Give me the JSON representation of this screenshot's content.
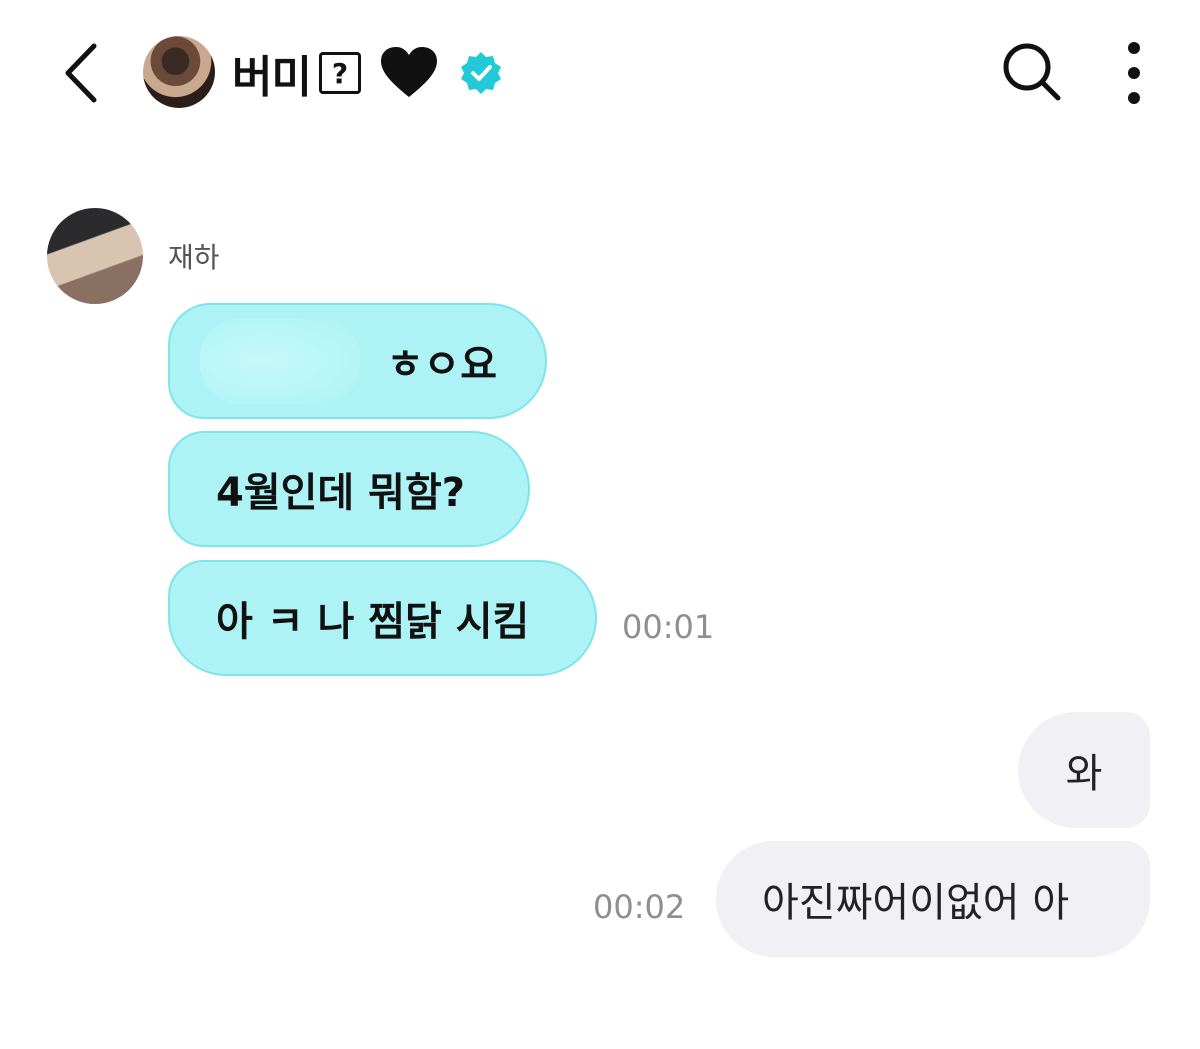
{
  "header": {
    "back_icon": "chevron-left-icon",
    "name": "버미",
    "unknown_glyph": "?",
    "emoji": "black-heart",
    "verified_badge_color": "#22c9d6",
    "search_icon": "search-icon",
    "more_icon": "vertical-ellipsis-icon"
  },
  "thread": {
    "incoming": {
      "sender_name": "재하",
      "bubble_color": "#adf3f5",
      "messages": [
        {
          "text": "ㅎㅇ요"
        },
        {
          "text": "4월인데 뭐함?"
        },
        {
          "text": "아 ㅋ 나 찜닭 시킴"
        }
      ],
      "time": "00:01"
    },
    "outgoing": {
      "bubble_color": "#f1f1f5",
      "messages": [
        {
          "text": "와"
        },
        {
          "text": "아진짜어이없어 아"
        }
      ],
      "time": "00:02"
    }
  }
}
